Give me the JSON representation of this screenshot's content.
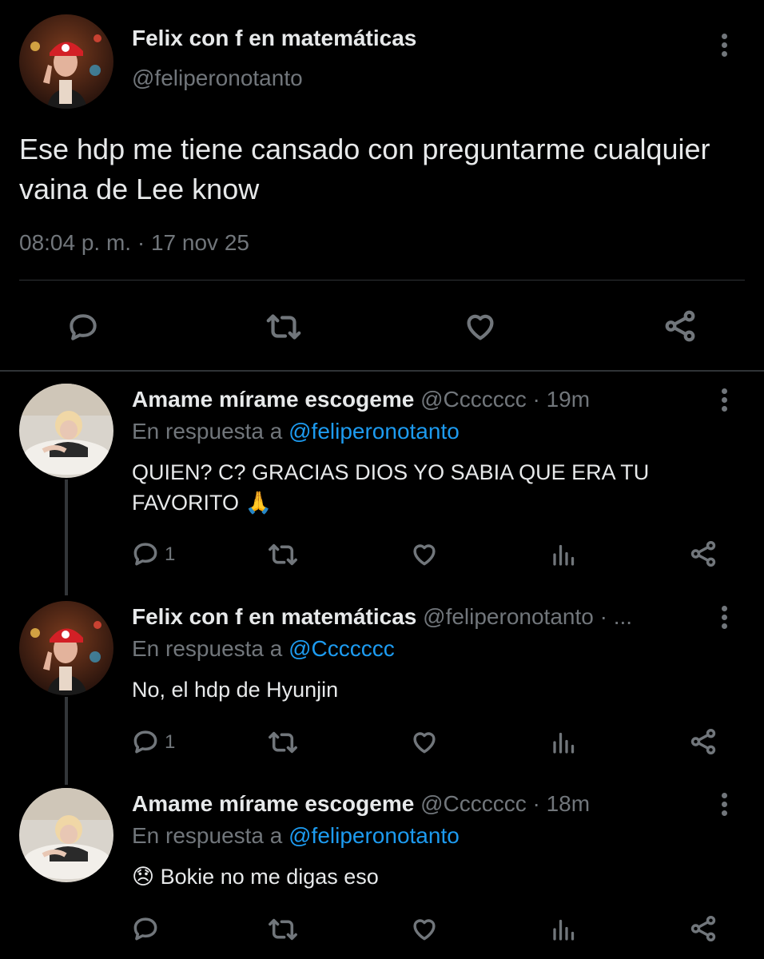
{
  "main_tweet": {
    "author_name": "Felix con f en matemáticas",
    "handle": "@feliperonotanto",
    "text": "Ese hdp me tiene cansado con preguntarme cualquier vaina de Lee know",
    "timestamp": "08:04 p. m. · 17 nov 25",
    "actions": [
      "reply-icon",
      "retweet-icon",
      "like-icon",
      "share-icon"
    ]
  },
  "replies": [
    {
      "author_name": "Amame mírame escogeme",
      "handle_time": "@Ccccccc · 19m",
      "reply_prefix": "En respuesta a",
      "reply_to": "@feliperonotanto",
      "text": "QUIEN? C? GRACIAS DIOS YO SABIA QUE ERA TU FAVORITO 🙏",
      "reply_count": "1"
    },
    {
      "author_name": "Felix con f en matemáticas",
      "handle_time": "@feliperonotanto · ...",
      "reply_prefix": "En respuesta a",
      "reply_to": "@Ccccccc",
      "text": "No, el hdp de Hyunjin",
      "reply_count": "1"
    },
    {
      "author_name": "Amame mírame escogeme",
      "handle_time": "@Ccccccc · 18m",
      "reply_prefix": "En respuesta a",
      "reply_to": "@feliperonotanto",
      "text": "😞 Bokie no me digas eso",
      "reply_count": ""
    }
  ],
  "colors": {
    "background": "#000000",
    "text": "#e7e9ea",
    "muted": "#71767b",
    "link": "#1d9bf0",
    "divider": "#2f3336"
  }
}
